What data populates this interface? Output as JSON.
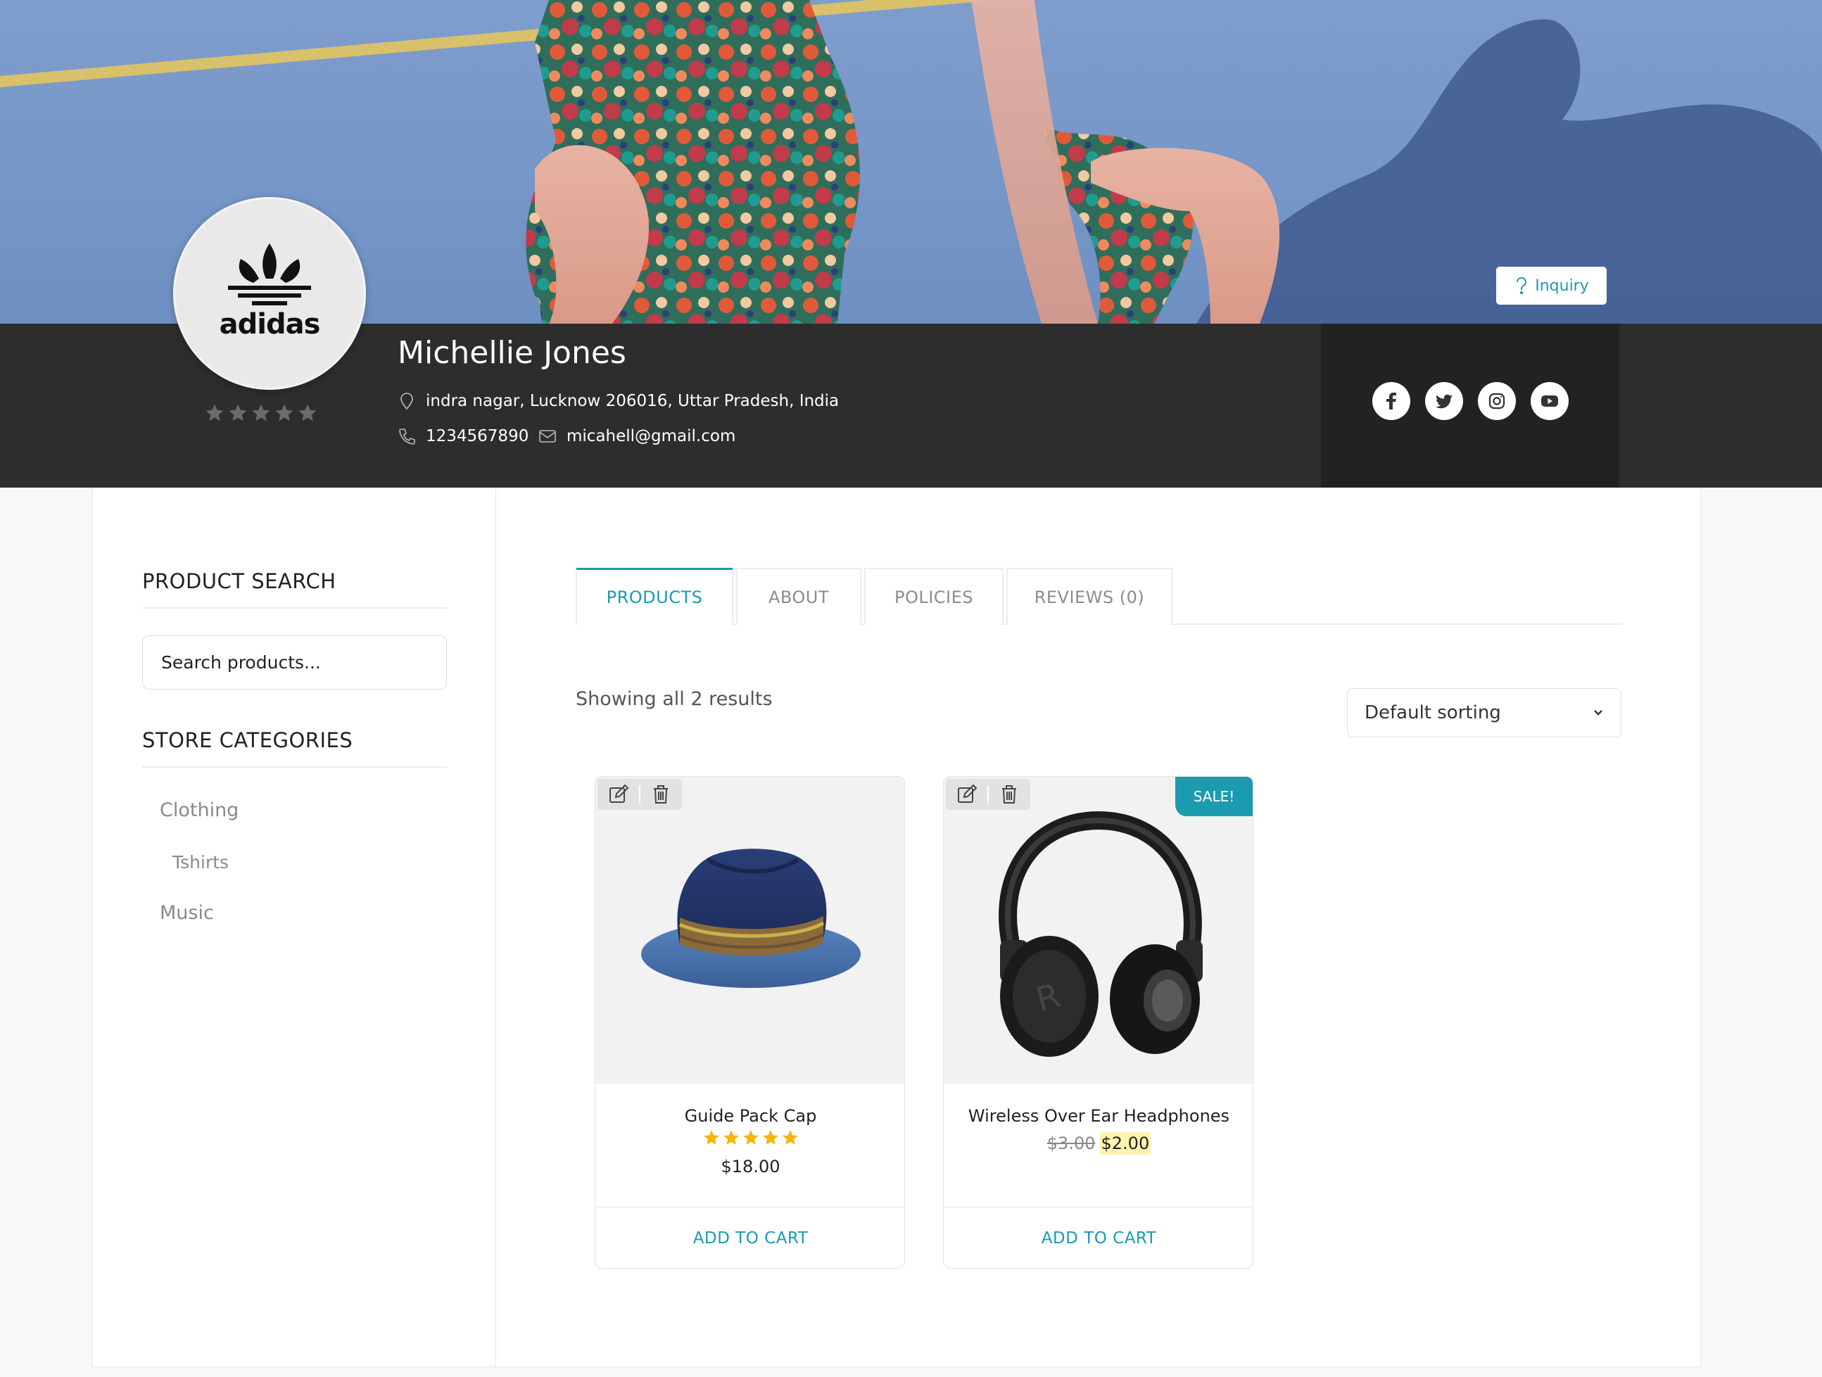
{
  "banner": {
    "inquiry_label": "Inquiry"
  },
  "store": {
    "logo_text": "adidas",
    "name": "Michellie Jones",
    "address": "indra nagar, Lucknow 206016, Uttar Pradesh, India",
    "phone": "1234567890",
    "email": "micahell@gmail.com",
    "rating": 0,
    "rating_max": 5,
    "socials": [
      "facebook-icon",
      "twitter-icon",
      "instagram-icon",
      "youtube-icon"
    ]
  },
  "sidebar": {
    "search_title": "PRODUCT SEARCH",
    "search_placeholder": "Search products...",
    "categories_title": "STORE CATEGORIES",
    "categories": [
      {
        "label": "Clothing",
        "level": 0
      },
      {
        "label": "Tshirts",
        "level": 1
      },
      {
        "label": "Music",
        "level": 0
      }
    ]
  },
  "tabs": [
    {
      "label": "PRODUCTS",
      "active": true
    },
    {
      "label": "ABOUT",
      "active": false
    },
    {
      "label": "POLICIES",
      "active": false
    },
    {
      "label": "REVIEWS (0)",
      "active": false
    }
  ],
  "results_text": "Showing all 2 results",
  "sort": {
    "selected": "Default sorting"
  },
  "products": [
    {
      "title": "Guide Pack Cap",
      "rating": 5,
      "price": "$18.00",
      "cart_label": "ADD TO CART"
    },
    {
      "title": "Wireless Over Ear Headphones",
      "sale_badge": "SALE!",
      "old_price": "$3.00",
      "price": "$2.00",
      "cart_label": "ADD TO CART"
    }
  ],
  "colors": {
    "accent": "#1a9bb0",
    "header_bar": "#2d2d2d",
    "star_gold": "#f5b50a"
  }
}
